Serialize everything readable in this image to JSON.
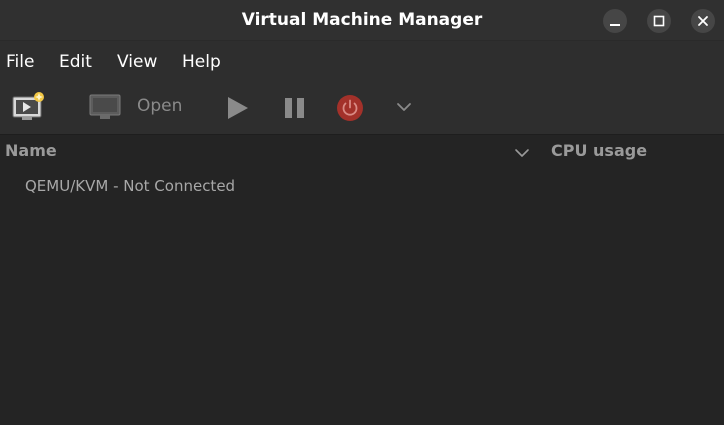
{
  "window": {
    "title": "Virtual Machine Manager"
  },
  "menubar": {
    "items": [
      {
        "label": "File"
      },
      {
        "label": "Edit"
      },
      {
        "label": "View"
      },
      {
        "label": "Help"
      }
    ]
  },
  "toolbar": {
    "new_vm_icon": "new-vm-icon",
    "open_icon": "monitor-icon",
    "open_label": "Open",
    "run_icon": "play-icon",
    "pause_icon": "pause-icon",
    "shutdown_icon": "power-icon",
    "menu_icon": "chevron-down-icon"
  },
  "list": {
    "columns": [
      {
        "label": "Name"
      },
      {
        "label": "CPU usage"
      }
    ],
    "rows": [
      {
        "label": "QEMU/KVM - Not Connected"
      }
    ]
  },
  "colors": {
    "background": "#242424",
    "titlebar": "#303030",
    "toolbar": "#2e2e2e",
    "power_button": "#a3312a",
    "disabled_icon": "#8a8a8a"
  }
}
